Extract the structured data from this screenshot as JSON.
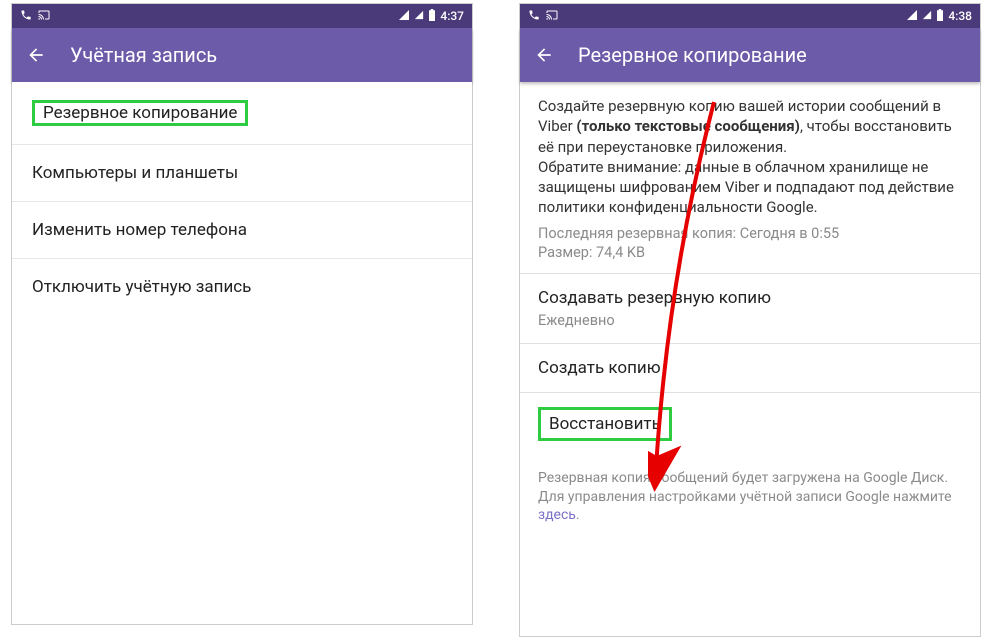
{
  "status": {
    "time_left": "4:37",
    "time_right": "4:38"
  },
  "left": {
    "title": "Учётная запись",
    "items": [
      "Резервное копирование",
      "Компьютеры и планшеты",
      "Изменить номер телефона",
      "Отключить учётную запись"
    ]
  },
  "right": {
    "title": "Резервное копирование",
    "desc_pre": "Создайте резервную копию вашей истории сообщений в Viber ",
    "desc_bold": "(только текстовые сообщения)",
    "desc_post": ", чтобы восстановить её при переустановке приложения.",
    "desc_note": "Обратите внимание: данные в облачном хранилище не защищены шифрованием Viber и подпадают под действие политики конфиденциальности Google.",
    "last_backup_label": "Последняя резервная копия: Сегодня в 0:55",
    "size_label": "Размер: 74,4 KB",
    "schedule_title": "Создавать резервную копию",
    "schedule_value": "Ежедневно",
    "create_label": "Создать копию",
    "restore_label": "Восстановить",
    "footer_pre": "Резервная копия сообщений будет загружена на Google Диск. Для управления настройками учётной записи Google нажмите ",
    "footer_link": "здесь",
    "footer_post": "."
  }
}
